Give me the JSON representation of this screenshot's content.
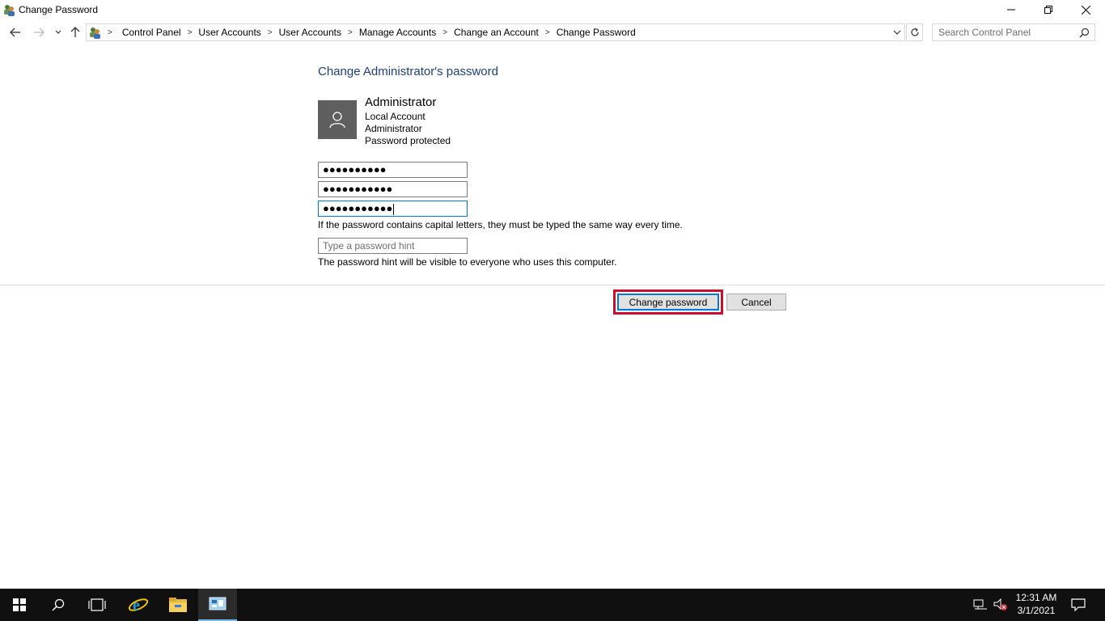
{
  "window": {
    "title": "Change Password",
    "minimize_icon": "minimize-icon",
    "restore_icon": "restore-icon",
    "close_icon": "close-icon"
  },
  "nav": {
    "back_icon": "arrow-left-icon",
    "forward_icon": "arrow-right-icon",
    "recent_icon": "chevron-down-icon",
    "up_icon": "arrow-up-icon"
  },
  "breadcrumbs": [
    "Control Panel",
    "User Accounts",
    "User Accounts",
    "Manage Accounts",
    "Change an Account",
    "Change Password"
  ],
  "search": {
    "placeholder": "Search Control Panel"
  },
  "page": {
    "heading": "Change Administrator's password",
    "account": {
      "name": "Administrator",
      "type": "Local Account",
      "group": "Administrator",
      "status": "Password protected"
    },
    "current_password_mask": "●●●●●●●●●●",
    "new_password_mask": "●●●●●●●●●●●",
    "confirm_password_mask": "●●●●●●●●●●●",
    "capital_note": "If the password contains capital letters, they must be typed the same way every time.",
    "hint_placeholder": "Type a password hint",
    "hint_note": "The password hint will be visible to everyone who uses this computer.",
    "change_button": "Change password",
    "cancel_button": "Cancel"
  },
  "taskbar": {
    "items": [
      "windows-start-icon",
      "search-icon",
      "task-view-icon",
      "internet-explorer-icon",
      "file-explorer-icon",
      "control-panel-icon"
    ],
    "time": "12:31 AM",
    "date": "3/1/2021"
  },
  "colors": {
    "heading": "#1c3f7a",
    "highlight": "#c8102e",
    "focus_border": "#0078d7",
    "taskbar": "#101010"
  }
}
